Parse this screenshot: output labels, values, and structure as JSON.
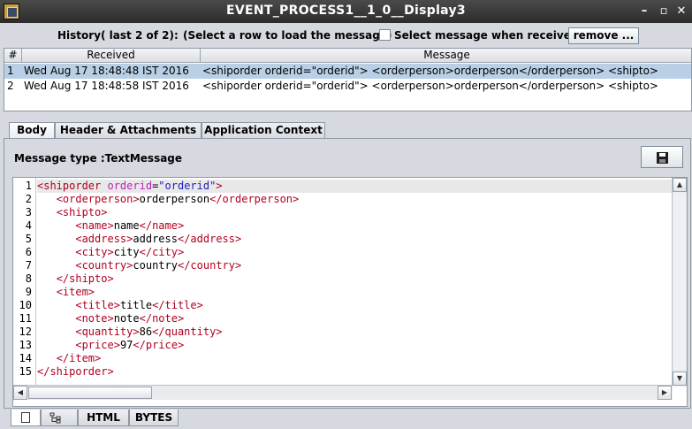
{
  "window": {
    "title": "EVENT_PROCESS1__1_0__Display3"
  },
  "history": {
    "label": "History( last 2 of 2):",
    "select_hint": "(Select a row to load the message)",
    "checkbox_label": "Select message when received",
    "remove_label": "remove ..."
  },
  "history_table": {
    "columns": [
      "#",
      "Received",
      "Message"
    ],
    "rows": [
      {
        "num": "1",
        "received": "Wed Aug 17 18:48:48 IST 2016",
        "message": "<shiporder orderid=\"orderid\">    <orderperson>orderperson</orderperson>    <shipto>"
      },
      {
        "num": "2",
        "received": "Wed Aug 17 18:48:58 IST 2016",
        "message": "<shiporder orderid=\"orderid\">    <orderperson>orderperson</orderperson>    <shipto>"
      }
    ]
  },
  "tabs": [
    "Body",
    "Header & Attachments",
    "Application Context"
  ],
  "body": {
    "message_type": "Message type :TextMessage"
  },
  "editor": {
    "lines": [
      {
        "n": "1",
        "indent": "",
        "parts": [
          [
            "tag",
            "<shiporder "
          ],
          [
            "attr",
            "orderid"
          ],
          [
            "txt",
            "="
          ],
          [
            "val",
            "\"orderid\""
          ],
          [
            "tag",
            ">"
          ]
        ]
      },
      {
        "n": "2",
        "indent": "   ",
        "parts": [
          [
            "tag",
            "<orderperson>"
          ],
          [
            "txt",
            "orderperson"
          ],
          [
            "tag",
            "</orderperson>"
          ]
        ]
      },
      {
        "n": "3",
        "indent": "   ",
        "parts": [
          [
            "tag",
            "<shipto>"
          ]
        ]
      },
      {
        "n": "4",
        "indent": "      ",
        "parts": [
          [
            "tag",
            "<name>"
          ],
          [
            "txt",
            "name"
          ],
          [
            "tag",
            "</name>"
          ]
        ]
      },
      {
        "n": "5",
        "indent": "      ",
        "parts": [
          [
            "tag",
            "<address>"
          ],
          [
            "txt",
            "address"
          ],
          [
            "tag",
            "</address>"
          ]
        ]
      },
      {
        "n": "6",
        "indent": "      ",
        "parts": [
          [
            "tag",
            "<city>"
          ],
          [
            "txt",
            "city"
          ],
          [
            "tag",
            "</city>"
          ]
        ]
      },
      {
        "n": "7",
        "indent": "      ",
        "parts": [
          [
            "tag",
            "<country>"
          ],
          [
            "txt",
            "country"
          ],
          [
            "tag",
            "</country>"
          ]
        ]
      },
      {
        "n": "8",
        "indent": "   ",
        "parts": [
          [
            "tag",
            "</shipto>"
          ]
        ]
      },
      {
        "n": "9",
        "indent": "   ",
        "parts": [
          [
            "tag",
            "<item>"
          ]
        ]
      },
      {
        "n": "10",
        "indent": "      ",
        "parts": [
          [
            "tag",
            "<title>"
          ],
          [
            "txt",
            "title"
          ],
          [
            "tag",
            "</title>"
          ]
        ]
      },
      {
        "n": "11",
        "indent": "      ",
        "parts": [
          [
            "tag",
            "<note>"
          ],
          [
            "txt",
            "note"
          ],
          [
            "tag",
            "</note>"
          ]
        ]
      },
      {
        "n": "12",
        "indent": "      ",
        "parts": [
          [
            "tag",
            "<quantity>"
          ],
          [
            "txt",
            "86"
          ],
          [
            "tag",
            "</quantity>"
          ]
        ]
      },
      {
        "n": "13",
        "indent": "      ",
        "parts": [
          [
            "tag",
            "<price>"
          ],
          [
            "txt",
            "97"
          ],
          [
            "tag",
            "</price>"
          ]
        ]
      },
      {
        "n": "14",
        "indent": "   ",
        "parts": [
          [
            "tag",
            "</item>"
          ]
        ]
      },
      {
        "n": "15",
        "indent": "",
        "parts": [
          [
            "tag",
            "</shiporder>"
          ]
        ]
      }
    ]
  },
  "bottom_tabs": {
    "html": "HTML",
    "bytes": "BYTES"
  },
  "icons": {
    "app": "app-icon",
    "minimize": "minimize-icon",
    "maximize": "maximize-icon",
    "close": "close-icon",
    "save": "floppy-save-icon",
    "text_view": "document-icon",
    "tree_view": "tree-icon"
  }
}
